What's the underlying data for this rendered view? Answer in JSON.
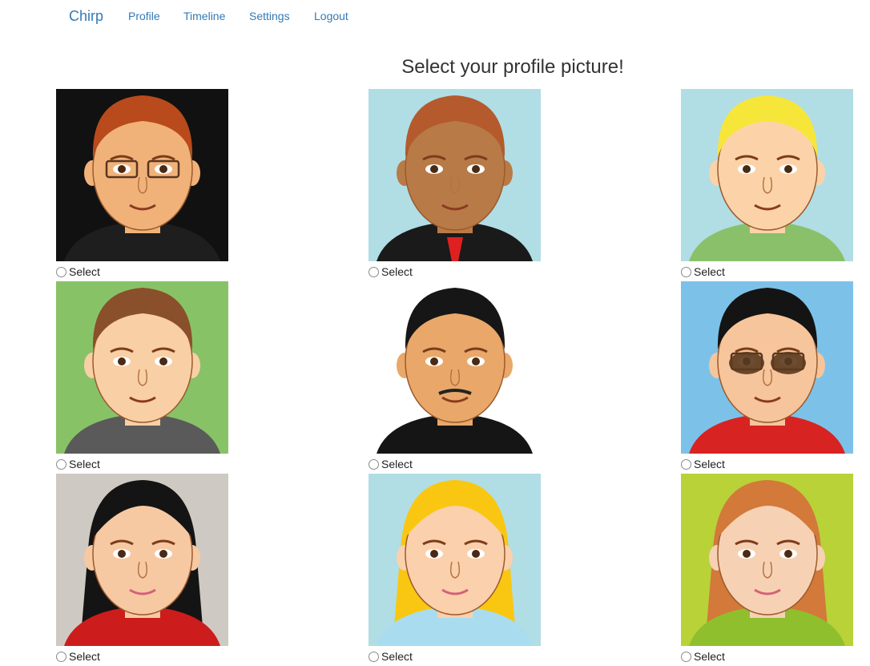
{
  "nav": {
    "brand": "Chirp",
    "links": [
      "Profile",
      "Timeline",
      "Settings",
      "Logout"
    ]
  },
  "page": {
    "heading": "Select your profile picture!"
  },
  "avatars": [
    {
      "icon": "man-glasses-red-hair-avatar-icon",
      "bg": "#111111",
      "skin": "#f1b27a",
      "hair": "#b94a1c",
      "shirt": "#1e1e1e",
      "select_label": "Select"
    },
    {
      "icon": "man-suit-red-tie-avatar-icon",
      "bg": "#b1dde5",
      "skin": "#b87a47",
      "hair": "#b55a2c",
      "shirt": "#1a1a1a",
      "select_label": "Select"
    },
    {
      "icon": "man-blond-hair-avatar-icon",
      "bg": "#b1dde5",
      "skin": "#fcd3a9",
      "hair": "#f6e63a",
      "shirt": "#8ac06a",
      "select_label": "Select"
    },
    {
      "icon": "man-brown-hair-hoodie-avatar-icon",
      "bg": "#88c267",
      "skin": "#f9cfa6",
      "hair": "#8a4f2b",
      "shirt": "#5a5a5a",
      "select_label": "Select"
    },
    {
      "icon": "man-black-hair-mustache-avatar-icon",
      "bg": "#ffffff",
      "skin": "#e9a86a",
      "hair": "#161616",
      "shirt": "#151515",
      "select_label": "Select"
    },
    {
      "icon": "man-sunglasses-avatar-icon",
      "bg": "#7cc2e8",
      "skin": "#f6c59b",
      "hair": "#141414",
      "shirt": "#d82323",
      "select_label": "Select"
    },
    {
      "icon": "woman-black-hair-scarf-avatar-icon",
      "bg": "#cfc9c3",
      "skin": "#f6c9a3",
      "hair": "#141414",
      "shirt": "#cc1c1c",
      "select_label": "Select"
    },
    {
      "icon": "woman-blonde-hair-avatar-icon",
      "bg": "#b1dde5",
      "skin": "#fbd0ac",
      "hair": "#f9c712",
      "shirt": "#aadcf0",
      "select_label": "Select"
    },
    {
      "icon": "woman-red-hair-avatar-icon",
      "bg": "#b8d238",
      "skin": "#f7d1b4",
      "hair": "#d3793a",
      "shirt": "#8fbf2d",
      "select_label": "Select"
    }
  ]
}
